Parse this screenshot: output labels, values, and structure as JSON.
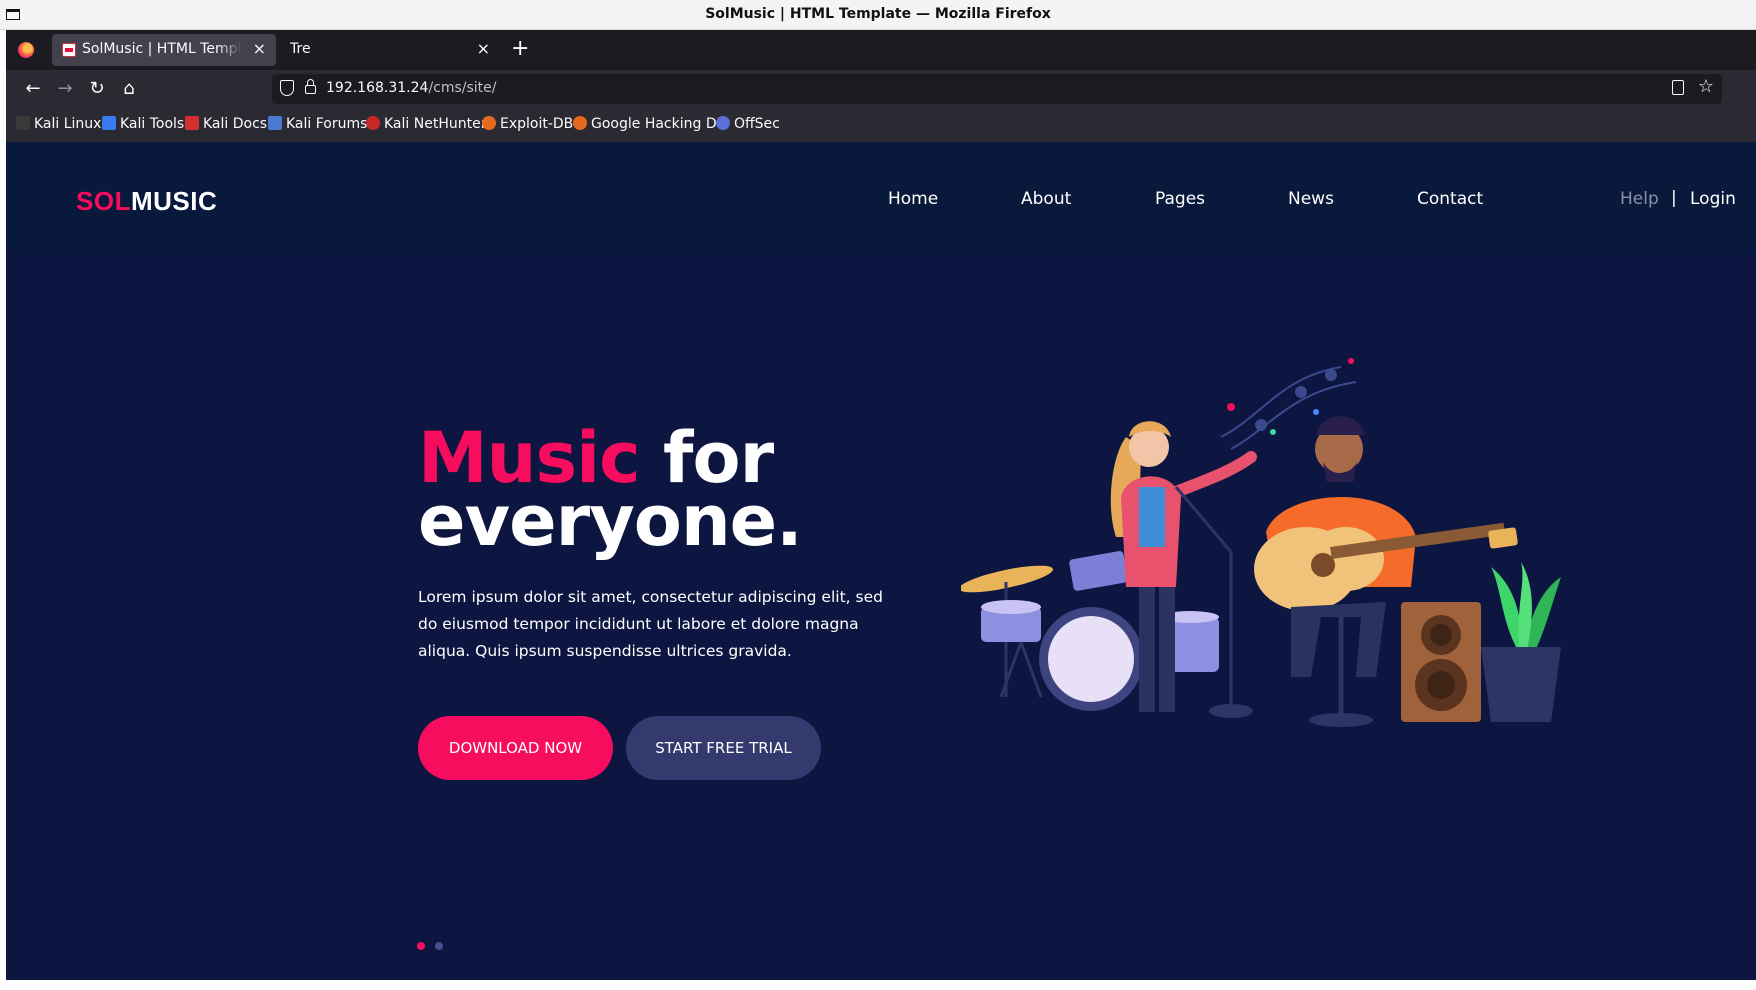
{
  "window": {
    "title": "SolMusic | HTML Template — Mozilla Firefox"
  },
  "browser": {
    "tabs": [
      {
        "label": "SolMusic | HTML Template",
        "active": true
      },
      {
        "label": "Tre",
        "active": false
      }
    ],
    "url_host": "192.168.31.24",
    "url_path": "/cms/site/",
    "bookmarks": [
      {
        "label": "Kali Linux",
        "icon": "kali-dragon-icon"
      },
      {
        "label": "Kali Tools",
        "icon": "kali-tools-icon"
      },
      {
        "label": "Kali Docs",
        "icon": "kali-docs-icon"
      },
      {
        "label": "Kali Forums",
        "icon": "kali-forums-icon"
      },
      {
        "label": "Kali NetHunter",
        "icon": "nethunter-icon"
      },
      {
        "label": "Exploit-DB",
        "icon": "exploit-db-icon"
      },
      {
        "label": "Google Hacking DB",
        "icon": "ghdb-icon"
      },
      {
        "label": "OffSec",
        "icon": "offsec-icon"
      }
    ]
  },
  "site": {
    "logo_sol": "SOL",
    "logo_music": "MUSIC",
    "menu": [
      "Home",
      "About",
      "Pages",
      "News",
      "Contact"
    ],
    "help": "Help",
    "separator": "|",
    "login": "Login",
    "hero": {
      "title_accent": "Music",
      "title_rest1": " for",
      "title_rest2": "everyone.",
      "text": "Lorem ipsum dolor sit amet, consectetur adipiscing elit, sed do eiusmod tempor incididunt ut labore et dolore magna aliqua. Quis ipsum suspendisse ultrices gravida.",
      "primary_button": "DOWNLOAD NOW",
      "secondary_button": "START FREE TRIAL",
      "slide_count": 2,
      "active_slide": 1
    },
    "colors": {
      "accent": "#f70d5e",
      "header_bg": "#09193b",
      "hero_bg": "#0d1541",
      "secondary_button": "#343a6d"
    }
  }
}
